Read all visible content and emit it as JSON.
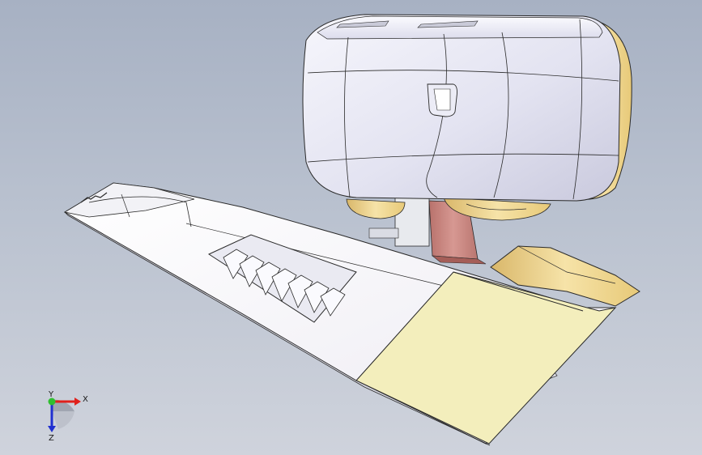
{
  "viewport": {
    "background_top": "#a7b1c3",
    "background_bottom": "#cfd3dc",
    "model_colors": {
      "body": "#ffffff",
      "housing": "#e6e6f4",
      "accent_face": "#f3eebc",
      "bearing": "#f2d78c",
      "column": "#e8eaee",
      "tilted_column": "#c98680"
    }
  },
  "triad": {
    "x_label": "X",
    "y_label": "Y",
    "z_label": "Z",
    "x_color": "#e0201c",
    "y_color": "#2fbf2f",
    "z_color": "#2030d0"
  }
}
